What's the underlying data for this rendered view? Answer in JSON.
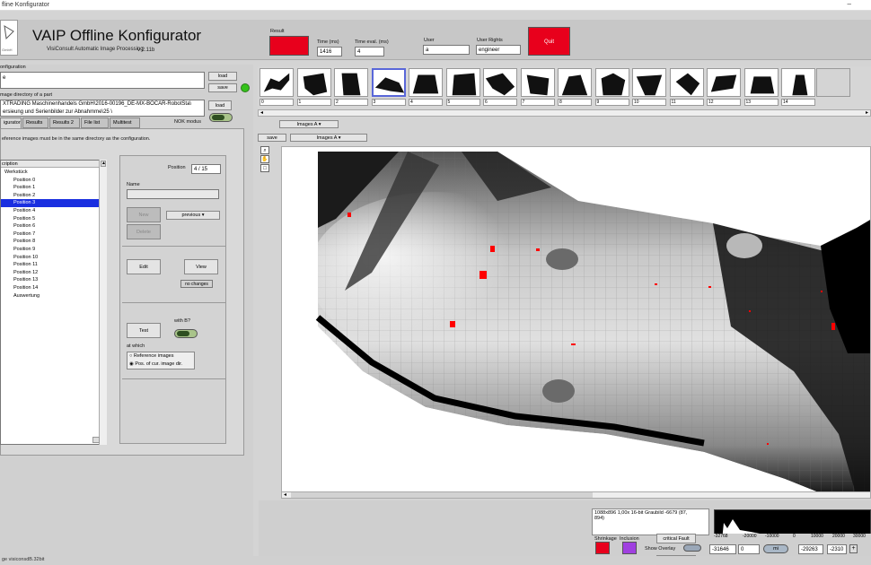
{
  "window": {
    "title": "fline Konfigurator",
    "minimize": "–"
  },
  "header": {
    "logo_text": "GmbH",
    "title": "VAIP Offline Konfigurator",
    "subtitle": "VisiConsult Automatic Image Processing",
    "version": "v 2.11b",
    "result_label": "Result",
    "result_color": "#e8001c",
    "time_label": "Time (ms)",
    "time_value": "1416",
    "time_eval_label": "Time eval. (ms)",
    "time_eval_value": "4",
    "user_label": "User",
    "user_value": "a",
    "user_rights_label": "User Rights",
    "user_rights_value": "engineer",
    "quit_label": "Quit"
  },
  "config": {
    "label": "onfiguration",
    "value": "e",
    "load_label": "load",
    "save_label": "save",
    "image_dir_label": "mage directory of a part",
    "image_dir_value_1": "XTRADING Maschinenhandels GmbH\\2016-00196_DE-MX-BOCAR-RobotSta\\",
    "image_dir_value_2": "ersieung und Serienbilder zur Abnahmme\\25 \\",
    "load2_label": "load",
    "nok_label": "NOK modus",
    "status_color": "#34c21a"
  },
  "tabs": [
    "igurator",
    "Results",
    "Results 2",
    "File list",
    "Multitest"
  ],
  "tab_note": "eference images must be in the same directory as the configuration.",
  "tree": {
    "header": "cription",
    "items": [
      {
        "label": "Werkstück",
        "root": true
      },
      {
        "label": "Position  0"
      },
      {
        "label": "Position  1"
      },
      {
        "label": "Position  2"
      },
      {
        "label": "Position  3",
        "selected": true
      },
      {
        "label": "Position  4"
      },
      {
        "label": "Position  5"
      },
      {
        "label": "Position  6"
      },
      {
        "label": "Position  7"
      },
      {
        "label": "Position  8"
      },
      {
        "label": "Position  9"
      },
      {
        "label": "Position  10"
      },
      {
        "label": "Position  11"
      },
      {
        "label": "Position  12"
      },
      {
        "label": "Position  13"
      },
      {
        "label": "Position  14"
      },
      {
        "label": "Auswertung"
      }
    ]
  },
  "controls": {
    "position_label": "Position",
    "position_value": "4 / 15",
    "name_label": "Name",
    "new_label": "New",
    "previous_label": "previous",
    "delete_label": "Delete",
    "edit_label": "Edit",
    "view_label": "View",
    "no_changes_label": "no changes",
    "test_label": "Test",
    "with_b_label": "with B?",
    "at_which_label": "at which",
    "radio_ref": "Reference images",
    "radio_pos": "Pos. of cur. image dir."
  },
  "thumbs": [
    "0",
    "1",
    "2",
    "3",
    "4",
    "5",
    "6",
    "7",
    "8",
    "9",
    "10",
    "11",
    "12",
    "13",
    "14"
  ],
  "viewer": {
    "images_select_top": "Images A",
    "save_label": "save",
    "images_select": "Images A"
  },
  "bottom": {
    "info_line1": "1088x896  1,00x  16-bit Graubild  -6679  (87,",
    "info_line2": "894)",
    "shrinkage_label": "Shrinkage",
    "inclusion_label": "Inclusion",
    "critical_fault_label": "critical Fault",
    "show_overlay_label": "Show Overlay",
    "reg_label": "reg",
    "shrinkage_color": "#e8001c",
    "inclusion_color": "#a040e0",
    "hist_ticks": [
      "-32768",
      "-20000",
      "-10000",
      "0",
      "10000",
      "20000",
      "30000"
    ],
    "min_value": "-31646",
    "zero_value": "0",
    "mi_label": "mi",
    "low_value": "-29263",
    "high_value": "-2310"
  },
  "statusbar": {
    "text": "ge visiconsdB.32bit"
  }
}
